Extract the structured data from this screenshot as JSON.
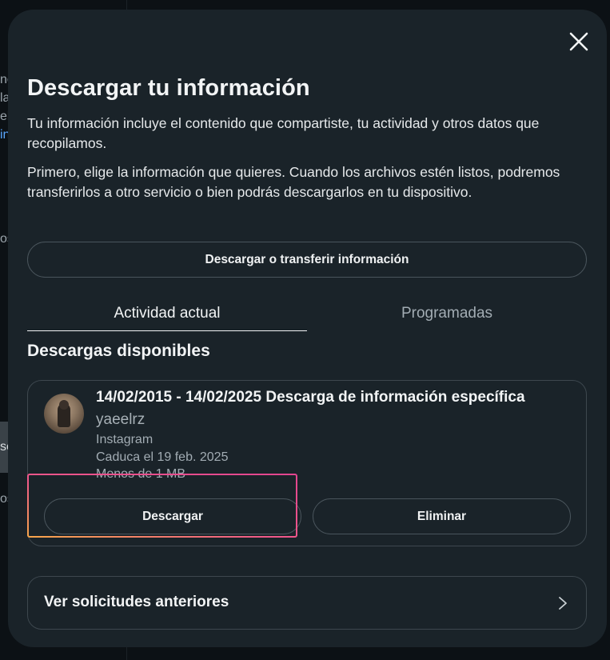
{
  "modal": {
    "title": "Descargar tu información",
    "intro": "Tu información incluye el contenido que compartiste, tu actividad y otros datos que recopilamos.",
    "instructions": "Primero, elige la información que quieres. Cuando los archivos estén listos, podremos transferirlos a otro servicio o bien podrás descargarlos en tu dispositivo.",
    "main_button": "Descargar o transferir información",
    "tabs": [
      {
        "label": "Actividad actual",
        "active": true
      },
      {
        "label": "Programadas",
        "active": false
      }
    ],
    "section_title": "Descargas disponibles",
    "download": {
      "title": "14/02/2015 - 14/02/2025 Descarga de información específica",
      "username": "yaeelrz",
      "platform": "Instagram",
      "expires": "Caduca el 19 feb. 2025",
      "size": "Menos de 1 MB",
      "download_button": "Descargar",
      "delete_button": "Eliminar"
    },
    "previous_requests": "Ver solicitudes anteriores"
  },
  "background": {
    "edge_fragments": [
      "ne",
      "la",
      "el",
      "in",
      "os",
      "sc",
      "os"
    ]
  },
  "colors": {
    "modal_bg": "#1a2329",
    "page_bg": "#0c1115",
    "border": "#3d474e",
    "highlight_start": "#f6a54b",
    "highlight_end": "#e2458f"
  }
}
